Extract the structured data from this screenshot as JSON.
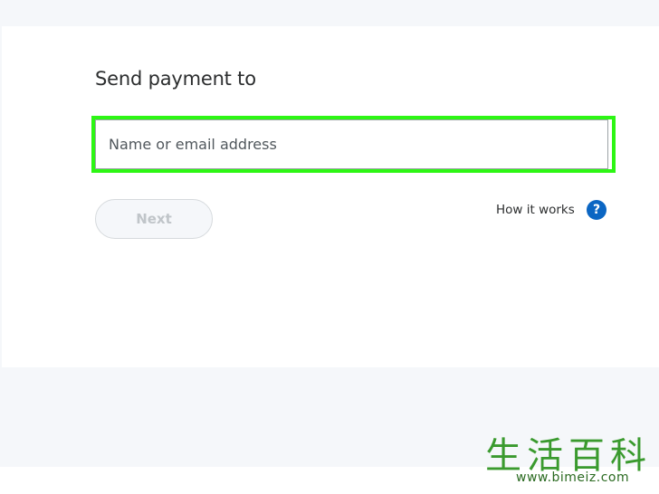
{
  "send": {
    "title": "Send payment to",
    "recipient_placeholder": "Name or email address",
    "recipient_value": "",
    "next_label": "Next",
    "how_it_works_label": "How it works",
    "help_icon_glyph": "?"
  },
  "watermark": {
    "logo_text": "生活百科",
    "url": "www.bimeiz.com"
  },
  "colors": {
    "highlight": "#2df614",
    "help_icon": "#0b66c3",
    "text": "#2c2e2f"
  }
}
